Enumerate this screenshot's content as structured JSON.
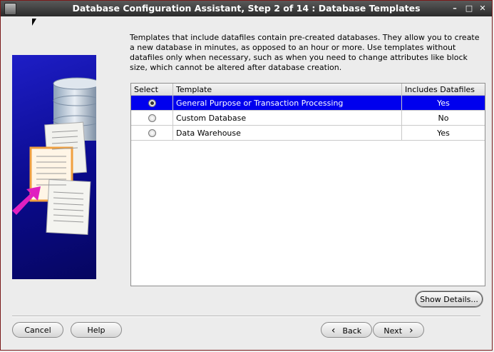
{
  "window": {
    "title": "Database Configuration Assistant, Step 2 of 14 : Database Templates",
    "min_glyph": "–",
    "max_glyph": "□",
    "close_glyph": "✕"
  },
  "description": "Templates that include datafiles contain pre-created databases. They allow you to create a new database in minutes, as opposed to an hour or more. Use templates without datafiles only when necessary, such as when you need to change attributes like block size, which cannot be altered after database creation.",
  "table": {
    "headers": [
      "Select",
      "Template",
      "Includes Datafiles"
    ],
    "rows": [
      {
        "template": "General Purpose or Transaction Processing",
        "datafiles": "Yes",
        "selected": true
      },
      {
        "template": "Custom Database",
        "datafiles": "No",
        "selected": false
      },
      {
        "template": "Data Warehouse",
        "datafiles": "Yes",
        "selected": false
      }
    ]
  },
  "buttons": {
    "show_details": "Show Details...",
    "cancel": "Cancel",
    "help": "Help",
    "back": "Back",
    "next": "Next",
    "back_glyph": "‹",
    "next_glyph": "›"
  },
  "colors": {
    "selection": "#0000ee",
    "side_panel": "#0a0a8c",
    "arrow": "#e020c0"
  }
}
